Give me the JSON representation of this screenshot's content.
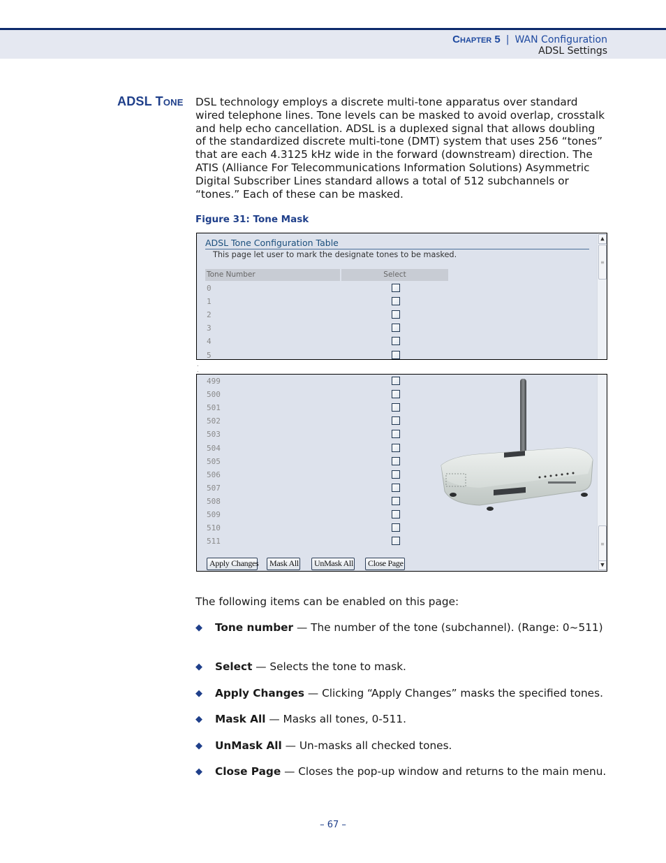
{
  "header": {
    "chapter": "Chapter 5",
    "separator": "|",
    "section": "WAN Configuration",
    "subsection": "ADSL Settings"
  },
  "section_title": "ADSL Tone",
  "intro": "DSL technology employs a discrete multi-tone apparatus over standard wired telephone lines. Tone levels can be masked to avoid overlap, crosstalk and help echo cancellation. ADSL is a duplexed signal that allows doubling of the standardized discrete multi-tone (DMT) system that uses 256 “tones” that are each 4.3125 kHz wide in the forward (downstream) direction. The ATIS (Alliance For Telecommunications Information Solutions) Asymmetric Digital Subscriber Lines standard allows a total of 512 subchannels or “tones.” Each of these can be masked.",
  "figure_caption": "Figure 31:  Tone Mask",
  "screenshot": {
    "title": "ADSL Tone Configuration Table",
    "description": "This page let user to mark the designate tones to be masked.",
    "columns": [
      "Tone Number",
      "Select"
    ],
    "top_rows": [
      {
        "tone": "0",
        "checked": false
      },
      {
        "tone": "1",
        "checked": false
      },
      {
        "tone": "2",
        "checked": false
      },
      {
        "tone": "3",
        "checked": false
      },
      {
        "tone": "4",
        "checked": false
      },
      {
        "tone": "5",
        "checked": false
      }
    ],
    "bottom_rows": [
      {
        "tone": "499",
        "checked": false
      },
      {
        "tone": "500",
        "checked": false
      },
      {
        "tone": "501",
        "checked": false
      },
      {
        "tone": "502",
        "checked": false
      },
      {
        "tone": "503",
        "checked": false
      },
      {
        "tone": "504",
        "checked": false
      },
      {
        "tone": "505",
        "checked": false
      },
      {
        "tone": "506",
        "checked": false
      },
      {
        "tone": "507",
        "checked": false
      },
      {
        "tone": "508",
        "checked": false
      },
      {
        "tone": "509",
        "checked": false
      },
      {
        "tone": "510",
        "checked": false
      },
      {
        "tone": "511",
        "checked": false
      }
    ],
    "buttons": {
      "apply": "Apply Changes",
      "mask_all": "Mask All",
      "unmask_all": "UnMask All",
      "close": "Close Page"
    },
    "scroll_icons": {
      "up": "▲",
      "down": "▼",
      "grip": "≡"
    },
    "image": "wireless-router"
  },
  "lead_text": "The following items can be enabled on this page:",
  "items": [
    {
      "term": "Tone number",
      "desc": " — The number of the tone (subchannel). (Range: 0~511)"
    },
    {
      "term": "Select",
      "desc": " — Selects the tone to mask."
    },
    {
      "term": "Apply Changes",
      "desc": " — Clicking “Apply Changes” masks the specified tones."
    },
    {
      "term": "Mask All",
      "desc": " — Masks all tones, 0-511."
    },
    {
      "term": "UnMask All",
      "desc": " — Un-masks all checked tones."
    },
    {
      "term": "Close Page",
      "desc": " — Closes the pop-up window and returns to the main menu."
    }
  ],
  "bullet_glyph": "◆",
  "page_number": "–  67  –"
}
